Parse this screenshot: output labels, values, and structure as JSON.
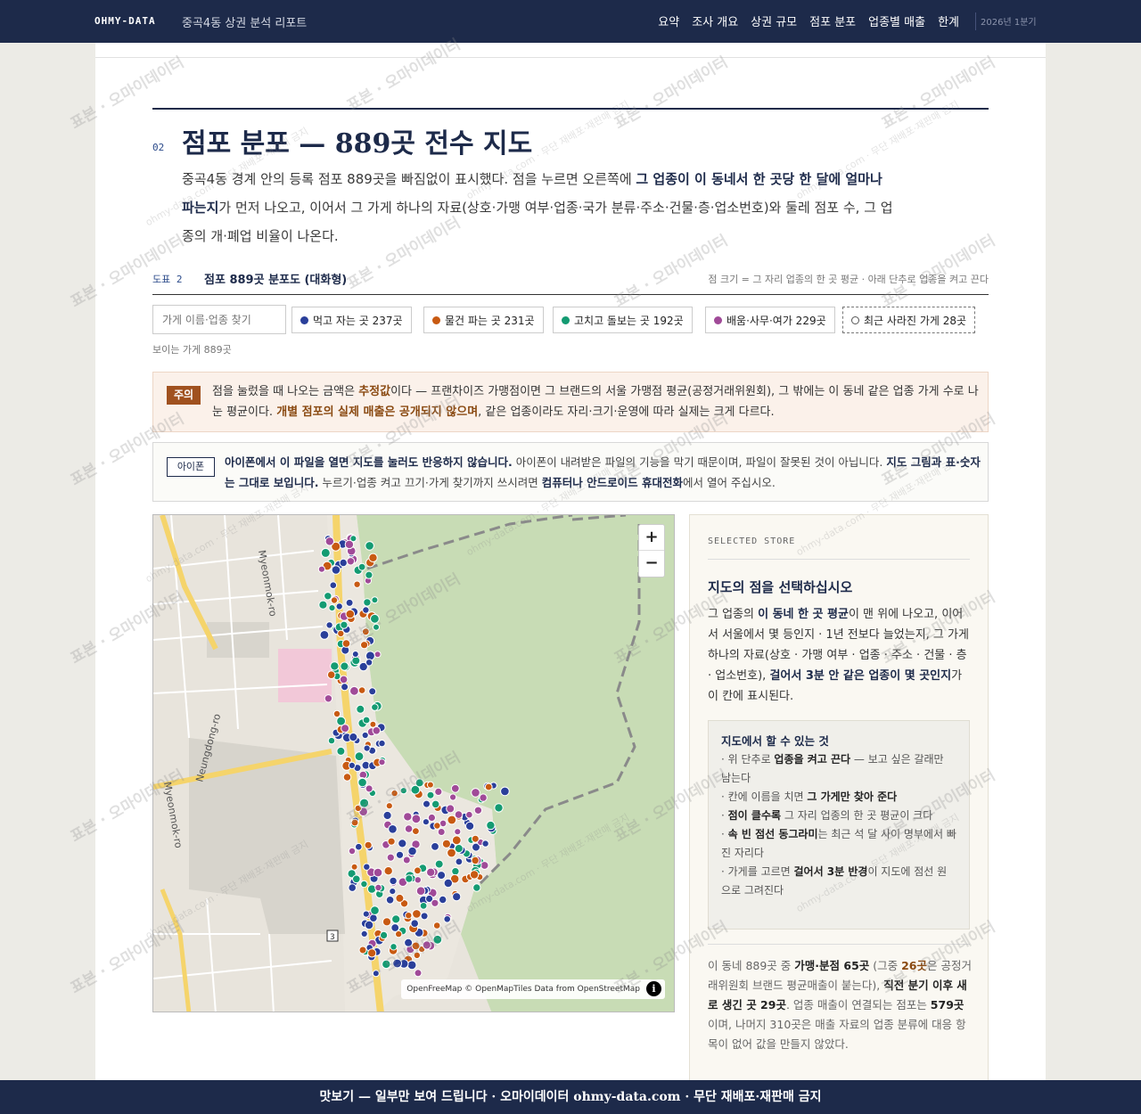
{
  "nav": {
    "brand": "OHMY-DATA",
    "subtitle": "중곡4동 상권 분석 리포트",
    "links": [
      "요약",
      "조사 개요",
      "상권 규모",
      "점포 분포",
      "업종별 매출",
      "한계"
    ],
    "period": "2026년 1분기"
  },
  "section": {
    "number": "02",
    "title": "점포 분포 — 889곳 전수 지도",
    "lead_1": "중곡4동 경계 안의 등록 점포 889곳을 빠짐없이 표시했다. 점을 누르면 오른쪽에 ",
    "lead_b1": "그 업종이 이 동네서 한 곳당 한 달에 얼마나 파는지",
    "lead_2": "가 먼저 나오고, 이어서 그 가게 하나의 자료(상호·가맹 여부·업종·국가 분류·주소·건물·층·업소번호)와 둘레 점포 수, 그 업종의 개·폐업 비율이 나온다."
  },
  "figure": {
    "label": "도표 2",
    "title": "점포 889곳 분포도 (대화형)",
    "note": "점 크기 = 그 자리 업종의 한 곳 평균 · 아래 단추로 업종을 켜고 끈다"
  },
  "filters": {
    "search_placeholder": "가게 이름·업종 찾기",
    "chips": [
      {
        "label": "먹고 자는 곳 237곳",
        "color": "#2a3f9a"
      },
      {
        "label": "물건 파는 곳 231곳",
        "color": "#c85a12"
      },
      {
        "label": "고치고 돌보는 곳 192곳",
        "color": "#149b72"
      },
      {
        "label": "배움·사무·여가 229곳",
        "color": "#a04a98"
      }
    ],
    "closed_chip": "최근 사라진 가게 28곳",
    "visible_count": "보이는 가게 889곳"
  },
  "caution": {
    "tag": "주의",
    "t1": "점을 눌렀을 때 나오는 금액은 ",
    "b1": "추정값",
    "t2": "이다 — 프랜차이즈 가맹점이면 그 브랜드의 서울 가맹점 평균(공정거래위원회), 그 밖에는 이 동네 같은 업종 가게 수로 나눈 평균이다. ",
    "b2": "개별 점포의 실제 매출은 공개되지 않으며",
    "t3": ", 같은 업종이라도 자리·크기·운영에 따라 실제는 크게 다르다."
  },
  "iphone": {
    "tag": "아이폰",
    "b1": "아이폰에서 이 파일을 열면 지도를 눌러도 반응하지 않습니다.",
    "t1": " 아이폰이 내려받은 파일의 기능을 막기 때문이며, 파일이 잘못된 것이 아닙니다. ",
    "b2": "지도 그림과 표·숫자는 그대로 보입니다.",
    "t2": " 누르기·업종 켜고 끄기·가게 찾기까지 쓰시려면 ",
    "b3": "컴퓨터나 안드로이드 휴대전화",
    "t3": "에서 열어 주십시오."
  },
  "map": {
    "zoom_in": "+",
    "zoom_out": "−",
    "attribution": "OpenFreeMap © OpenMapTiles Data from OpenStreetMap",
    "info": "i",
    "road_labels": [
      "Myeonmok-ro",
      "Neungdong-ro",
      "Myeonmok-ro",
      "3"
    ]
  },
  "panel": {
    "kicker": "SELECTED STORE",
    "title": "지도의 점을 선택하십시오",
    "p1": "그 업종의 ",
    "p1b": "이 동네 한 곳 평균",
    "p2": "이 맨 위에 나오고, 이어서 서울에서 몇 등인지 · 1년 전보다 늘었는지, 그 가게 하나의 자료(상호 · 가맹 여부 · 업종 · 주소 · 건물 · 층 · 업소번호), ",
    "p2b": "걸어서 3분 안 같은 업종이 몇 곳인지",
    "p3": "가 이 칸에 표시된다.",
    "howto_title": "지도에서 할 수 있는 것",
    "howto": [
      {
        "pre": "· 위 단추로 ",
        "b": "업종을 켜고 끈다",
        "post": " — 보고 싶은 갈래만 남는다"
      },
      {
        "pre": "· 칸에 이름을 치면 ",
        "b": "그 가게만 찾아 준다",
        "post": ""
      },
      {
        "pre": "· ",
        "b": "점이 클수록",
        "post": " 그 자리 업종의 한 곳 평균이 크다"
      },
      {
        "pre": "· ",
        "b": "속 빈 점선 동그라미",
        "post": "는 최근 석 달 사이 명부에서 빠진 자리다"
      },
      {
        "pre": "· 가게를 고르면 ",
        "b": "걸어서 3분 반경",
        "post": "이 지도에 점선 원으로 그려진다"
      }
    ],
    "s1": "이 동네 889곳 중 ",
    "s1b": "가맹·분점 65곳",
    "s2": " (그중 ",
    "s2hl": "26곳",
    "s3": "은 공정거래위원회 브랜드 평균매출이 붙는다), ",
    "s3b": "직전 분기 이후 새로 생긴 곳 29곳",
    "s4": ". 업종 매출이 연결되는 점포는 ",
    "s4b": "579곳",
    "s5": "이며, 나머지 310곳은 매출 자료의 업종 분류에 대응 항목이 없어 값을 만들지 않았다."
  },
  "footer": "맛보기 — 일부만 보여 드립니다 · 오마이데이터 ohmy-data.com · 무단 재배포·재판매 금지",
  "watermark": {
    "main": "표본 · 오마이데이터",
    "secondary": "ohmy-data.com · 무단 재배포·재판매 금지"
  },
  "colors": {
    "navy": "#1d2a4a",
    "food": "#2a3f9a",
    "retail": "#c85a12",
    "service": "#149b72",
    "office": "#a04a98",
    "caution": "#a0511f"
  }
}
